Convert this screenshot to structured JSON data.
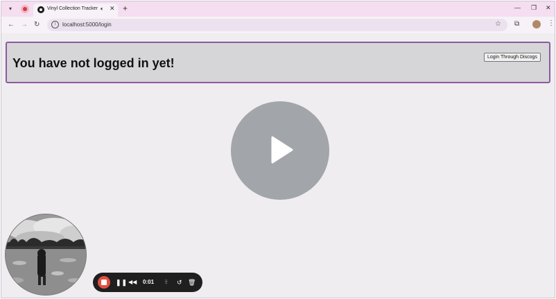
{
  "browser": {
    "tab": {
      "title": "Vinyl Collection Tracker"
    },
    "omnibox": {
      "url": "localhost:5000/login"
    }
  },
  "page": {
    "heading": "You have not logged in yet!",
    "login_button_label": "Login Through Discogs"
  },
  "recorder": {
    "elapsed": "0:01"
  },
  "colors": {
    "tabstrip": "#f4def0",
    "banner_border": "#8a5aa0",
    "record_stop": "#e25141"
  }
}
